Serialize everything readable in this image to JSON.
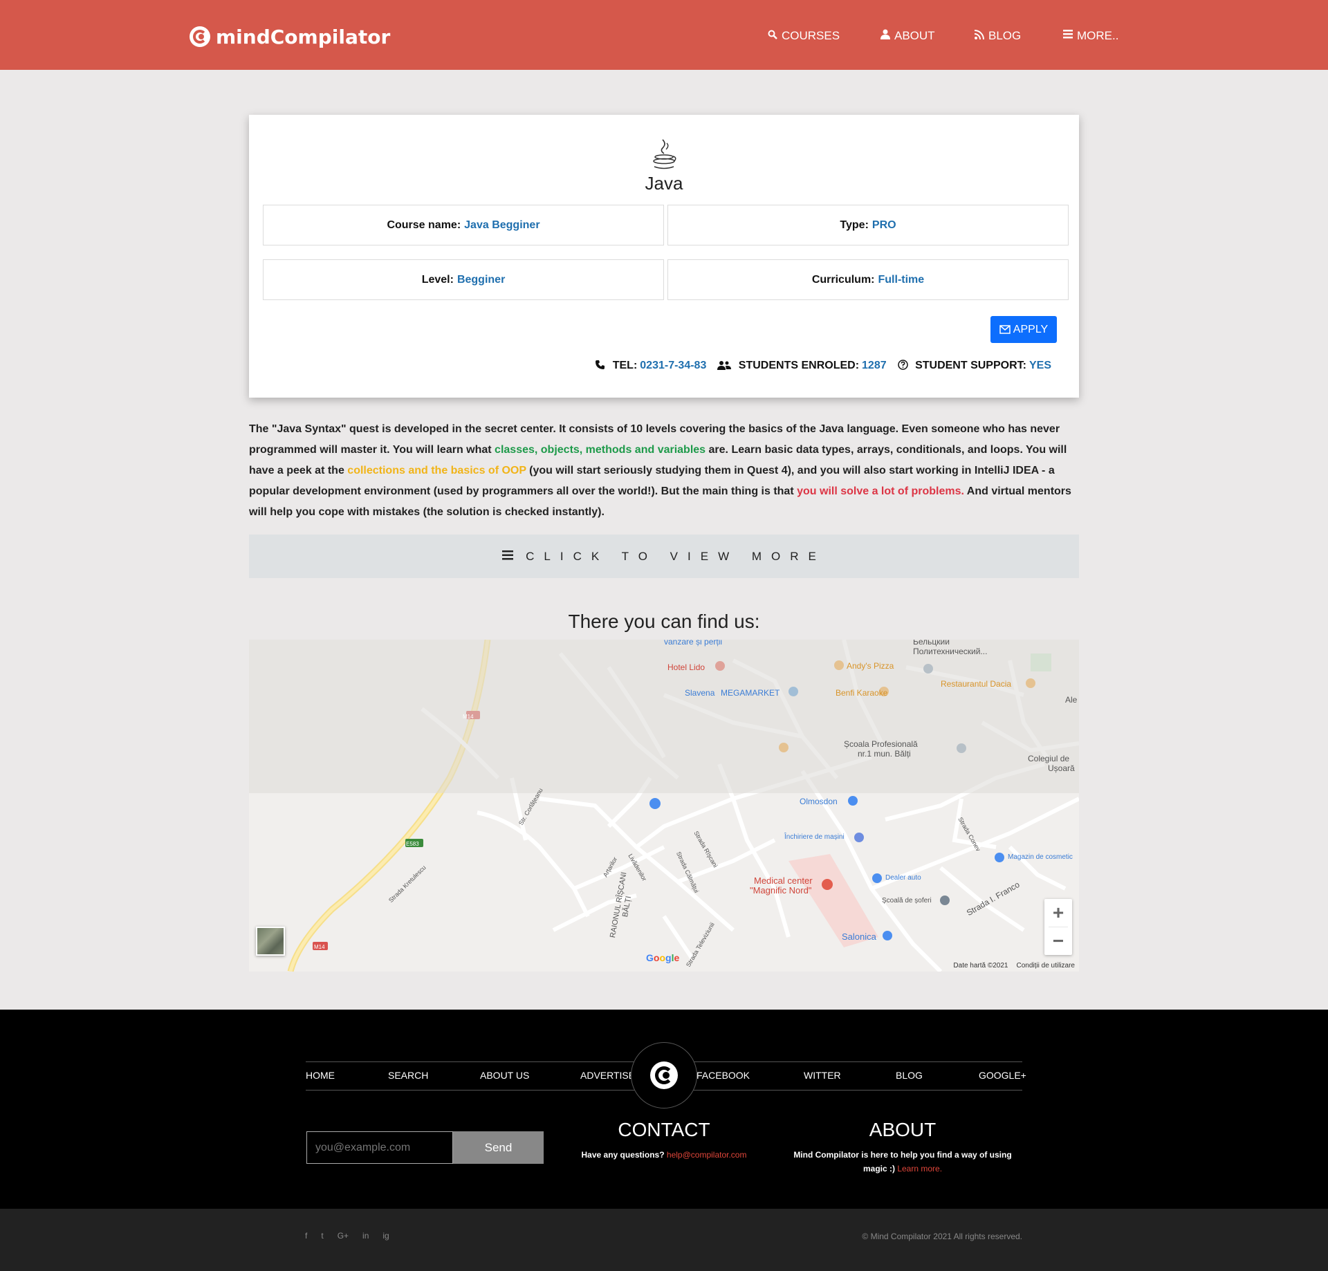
{
  "navbar": {
    "brand": "mindCompilator",
    "links": [
      {
        "label": "COURSES",
        "icon": "search-icon"
      },
      {
        "label": "ABOUT",
        "icon": "user-icon"
      },
      {
        "label": "BLOG",
        "icon": "rss-icon"
      },
      {
        "label": "MORE..",
        "icon": "bars-icon"
      }
    ]
  },
  "course": {
    "title": "Java",
    "name_label": "Course name:",
    "name_value": "Java Begginer",
    "type_label": "Type:",
    "type_value": "PRO",
    "level_label": "Level:",
    "level_value": "Begginer",
    "curriculum_label": "Curriculum:",
    "curriculum_value": "Full-time",
    "apply_label": "APPLY",
    "tel_label": "TEL:",
    "tel_value": "0231-7-34-83",
    "students_label": "STUDENTS ENROLED:",
    "students_value": "1287",
    "support_label": "STUDENT SUPPORT:",
    "support_value": "YES"
  },
  "description": {
    "part1": "The \"Java Syntax\" quest is developed in the secret center. It consists of 10 levels covering the basics of the Java language. Even someone who has never programmed will master it. You will learn what ",
    "hl1": "classes, objects, methods and variables",
    "part2": " are. Learn basic data types, arrays, conditionals, and loops. You will have a peek at the ",
    "hl2": "collections and the basics of OOP",
    "part3": " (you will start seriously studying them in Quest 4), and you will also start working in IntelliJ IDEA - a popular development environment (used by programmers all over the world!). But the main thing is that ",
    "hl3": "you will solve a lot of problems.",
    "part4": " And virtual mentors will help you cope with mistakes (the solution is checked instantly)."
  },
  "more_bar": {
    "label": "CLICK TO VIEW MORE"
  },
  "find_us": "There you can find us:",
  "map": {
    "labels": {
      "belcy": "Бельцкий",
      "politech": "Политехнический...",
      "vanzare": "vânzare și perții",
      "hotel": "Hotel Lido",
      "andys": "Andy's Pizza",
      "dacia": "Restaurantul Dacia",
      "slavena": "Slavena",
      "megamarket": "MEGAMARKET",
      "benfi": "Benfi Karaoke",
      "scoala_prof": "Școala Profesională",
      "scoala_prof2": "nr.1 mun. Bălți",
      "colegiul": "Colegiul de",
      "usoara": "Ușoară",
      "ale": "Ale",
      "olmosdon": "Olmosdon",
      "inchiriere": "Închiriere de mașini",
      "magazin": "Magazin de cosmetic",
      "dealer": "Dealer auto",
      "medical": "Medical center",
      "magnific": "\"Magnific Nord\"",
      "scoala_soferi": "Școală de șoferi",
      "salonica": "Salonica",
      "m14": "M14",
      "e583": "E583",
      "raionul": "RAIONUL RÎȘCANI",
      "balti": "BĂLȚI",
      "str_franco": "Strada I. Franco",
      "str_riscani": "Strada Rîșcani",
      "str_calmatui": "Strada Călmățui",
      "str_kretulescu": "Strada Kretulescu",
      "str_coriolanu": "Str. Corlățeanu",
      "str_televiziunii": "Strada Televiziunii",
      "str_conev": "Strada Conev",
      "livadea": "Livădenilor",
      "artarilor": "Arțarilor"
    },
    "google": "Google",
    "attribution": "Date hartă ©2021",
    "terms": "Condiții de utilizare",
    "zoom_in": "+",
    "zoom_out": "−"
  },
  "footer": {
    "nav": [
      "HOME",
      "SEARCH",
      "ABOUT US",
      "ADVERTISE",
      "FACEBOOK",
      "WITTER",
      "BLOG",
      "GOOGLE+"
    ],
    "email_placeholder": "you@example.com",
    "send_label": "Send",
    "contact_title": "CONTACT",
    "contact_text": "Have any questions?",
    "contact_email": "help@compilator.com",
    "about_title": "ABOUT",
    "about_text": "Mind Compilator is here to help you find a way of using magic :)",
    "about_link": "Learn more.",
    "social": [
      "f",
      "t",
      "G+",
      "in",
      "ig"
    ],
    "copyright": "© Mind Compilator 2021 All rights reserved."
  },
  "colors": {
    "navbar_bg": "#d5584b",
    "accent_blue": "#1f6fae",
    "apply_blue": "#0d6efd",
    "footer_bg": "#000000",
    "bottom_bg": "#222222"
  }
}
